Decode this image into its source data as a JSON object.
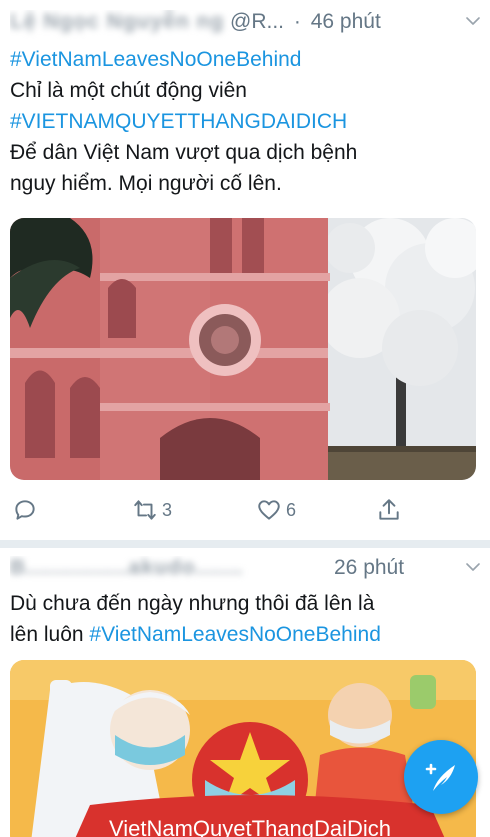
{
  "tweets": [
    {
      "author_name": "Lệ Ngọc Nguyễn ng",
      "handle": "@R...",
      "separator": "·",
      "time": "46 phút",
      "lines": [
        {
          "text": "#VietNamLeavesNoOneBehind",
          "type": "hashtag"
        },
        {
          "text": "Chỉ là một chút động viên",
          "type": "text"
        },
        {
          "text": "#VIETNAMQUYETTHANGDAIDICH",
          "type": "hashtag"
        },
        {
          "text": "Để dân Việt Nam vượt qua dịch bệnh",
          "type": "text"
        },
        {
          "text": "nguy hiểm. Mọi người cố lên.",
          "type": "text"
        }
      ],
      "media_alt": "Pink church and white tree",
      "actions": {
        "reply_count": "",
        "retweet_count": "3",
        "like_count": "6"
      }
    },
    {
      "author_name": "B...............akudo.......",
      "time": "26 phút",
      "line1": "Dù chưa đến ngày nhưng thôi đã lên là",
      "line2_text": "lên luôn ",
      "line2_hashtag": "#VietNamLeavesNoOneBehind",
      "media_banner": "VietNamQuyetThangDaiDich"
    }
  ],
  "icons": {
    "chevron": "chevron-down-icon",
    "reply": "reply-icon",
    "retweet": "retweet-icon",
    "like": "heart-icon",
    "share": "share-icon",
    "compose": "compose-tweet-icon"
  },
  "colors": {
    "hashtag": "#1b95e0",
    "meta": "#657786",
    "fab": "#1da1f2",
    "divider": "#e6ecf0"
  }
}
